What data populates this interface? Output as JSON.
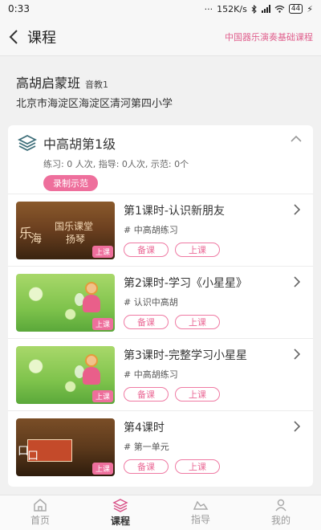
{
  "status_bar": {
    "time": "0:33",
    "network_speed": "152K/s",
    "battery": "44"
  },
  "header": {
    "title": "课程",
    "right_link": "中国器乐演奏基础课程"
  },
  "class_info": {
    "name": "高胡启蒙班",
    "tag": "音教1",
    "address": "北京市海淀区海淀区清河第四小学"
  },
  "level": {
    "name": "中高胡第1级",
    "stats": "练习: 0 人次, 指导: 0人次, 示范: 0个",
    "record_button": "录制示范"
  },
  "lessons": [
    {
      "title": "第1课时-认识新朋友",
      "tag": "中高胡练习",
      "thumb_badge": "上课",
      "thumb_text_1": "乐",
      "thumb_text_2": "海",
      "thumb_text_3": "国乐课堂",
      "thumb_text_4": "扬琴",
      "prepare_label": "备课",
      "teach_label": "上课"
    },
    {
      "title": "第2课时-学习《小星星》",
      "tag": "认识中高胡",
      "thumb_badge": "上课",
      "prepare_label": "备课",
      "teach_label": "上课"
    },
    {
      "title": "第3课时-完整学习小星星",
      "tag": "中高胡练习",
      "thumb_badge": "上课",
      "prepare_label": "备课",
      "teach_label": "上课"
    },
    {
      "title": "第4课时",
      "tag": "第一单元",
      "thumb_badge": "上课",
      "thumb_text_1": "口",
      "thumb_text_2": "口",
      "prepare_label": "备课",
      "teach_label": "上课"
    }
  ],
  "tag_prefix": "#",
  "bottom_nav": [
    {
      "label": "首页",
      "icon": "home-icon"
    },
    {
      "label": "课程",
      "icon": "layers-icon",
      "active": true
    },
    {
      "label": "指导",
      "icon": "guide-icon"
    },
    {
      "label": "我的",
      "icon": "person-icon"
    }
  ],
  "colors": {
    "accent": "#ee6f9c",
    "accent_text": "#e0608e"
  }
}
